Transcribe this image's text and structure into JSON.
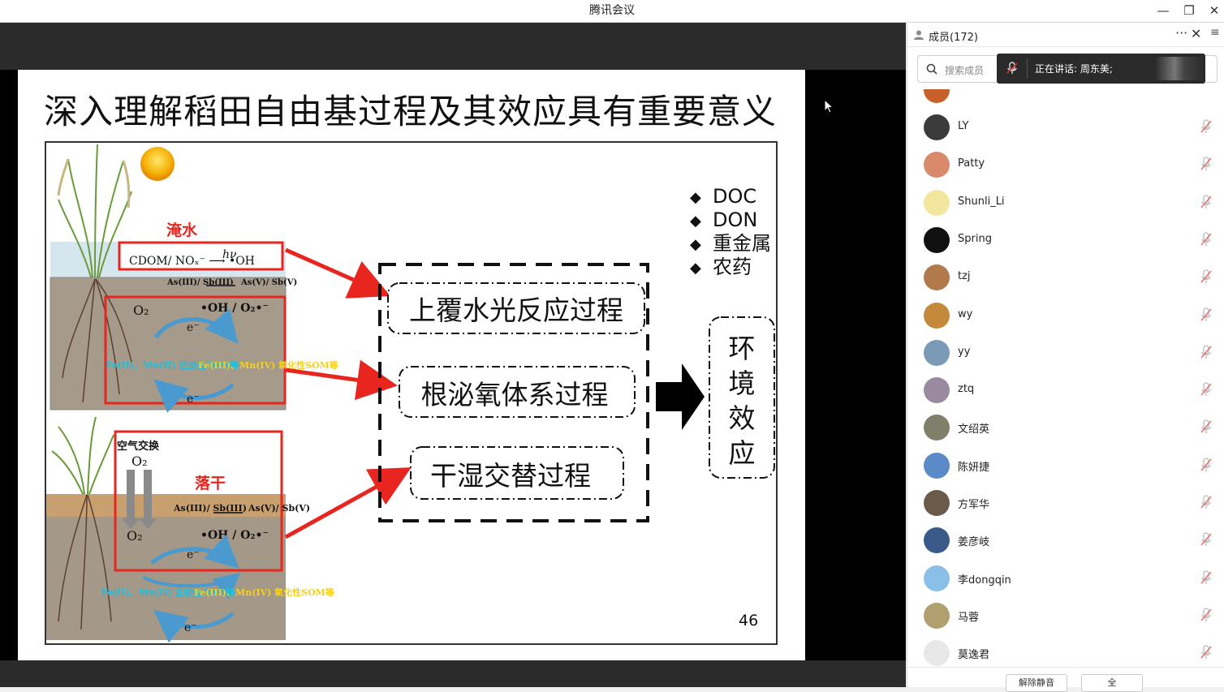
{
  "window": {
    "title": "腾讯会议",
    "minimize": "—",
    "restore": "❐",
    "close": "✕"
  },
  "slide": {
    "title": "深入理解稻田自由基过程及其效应具有重要意义",
    "flood_label": "淹水",
    "dry_label": "落干",
    "air_exchange": "空气交换",
    "photo_reaction": "CDOM/ NOₓ⁻ ⟶ •OH",
    "hv": "hν",
    "as_sb_reduced": "As(III)/ Sb(III)",
    "as_sb_oxidized": "As(V)/ Sb(V)",
    "o2": "O₂",
    "oh_o2": "•OH / O₂•⁻",
    "electron": "e⁻",
    "fe_mn_reduced": "Fe(II)、Mn(II) 还原性SOM等",
    "fe_mn_oxidized": "Fe(III)、Mn(IV) 氧化性SOM等",
    "process_1": "上覆水光反应过程",
    "process_2": "根泌氧体系过程",
    "process_3": "干湿交替过程",
    "effect_chars": [
      "环",
      "境",
      "效",
      "应"
    ],
    "bullets": [
      "DOC",
      "DON",
      "重金属",
      "农药"
    ],
    "bullet_mark": "◆",
    "page_number": "46"
  },
  "panel": {
    "title": "成员(172)",
    "more": "···",
    "close": "✕",
    "menu": "≡",
    "search_placeholder": "搜索成员",
    "speaking_toast": "正在讲话: 周东美;",
    "members": [
      {
        "name": "LY",
        "color": "#3b3b3b"
      },
      {
        "name": "Patty",
        "color": "#d98a6a"
      },
      {
        "name": "Shunli_Li",
        "color": "#f3e7a0"
      },
      {
        "name": "Spring",
        "color": "#111111"
      },
      {
        "name": "tzj",
        "color": "#b07a4a"
      },
      {
        "name": "wy",
        "color": "#c48a3a"
      },
      {
        "name": "yy",
        "color": "#7a9ab8"
      },
      {
        "name": "ztq",
        "color": "#9a8aa0"
      },
      {
        "name": "文绍英",
        "color": "#7f7f6a"
      },
      {
        "name": "陈妍捷",
        "color": "#5a8ac8"
      },
      {
        "name": "方军华",
        "color": "#6a5a4a"
      },
      {
        "name": "姜彦岐",
        "color": "#3a5a8a"
      },
      {
        "name": "李dongqin",
        "color": "#8ac0e8"
      },
      {
        "name": "马蓉",
        "color": "#b0a070"
      },
      {
        "name": "莫逸君",
        "color": "#e8e8e8"
      }
    ],
    "btn_unmute_all": "解除静音",
    "btn_other": "全"
  }
}
